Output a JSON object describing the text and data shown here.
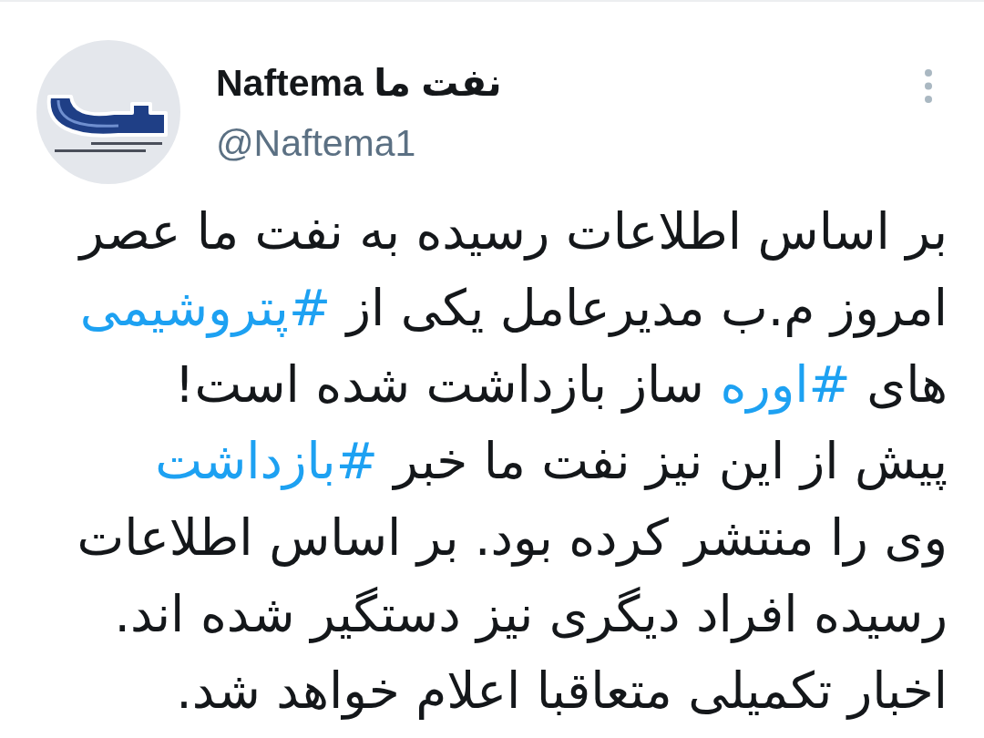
{
  "tweet": {
    "author": {
      "display_name": "Naftema نفت ما",
      "handle": "@Naftema1"
    },
    "lines": [
      [
        {
          "kind": "text",
          "text": "بر اساس اطلاعات رسیده به نفت ما عصر"
        }
      ],
      [
        {
          "kind": "text",
          "text": "امروز م.ب مدیرعامل یکی از "
        },
        {
          "kind": "hashtag",
          "text": "#پتروشیمی"
        }
      ],
      [
        {
          "kind": "text",
          "text": "های "
        },
        {
          "kind": "hashtag",
          "text": "#اوره"
        },
        {
          "kind": "text",
          "text": " ساز بازداشت شده است!"
        }
      ],
      [
        {
          "kind": "text",
          "text": "پیش از این نیز نفت ما خبر "
        },
        {
          "kind": "hashtag",
          "text": "#بازداشت"
        }
      ],
      [
        {
          "kind": "text",
          "text": "وی را منتشر کرده بود. بر اساس اطلاعات"
        }
      ],
      [
        {
          "kind": "text",
          "text": "رسیده افراد دیگری نیز دستگیر شده اند."
        }
      ],
      [
        {
          "kind": "text",
          "text": "اخبار تکمیلی متعاقبا اعلام خواهد شد."
        }
      ]
    ]
  }
}
